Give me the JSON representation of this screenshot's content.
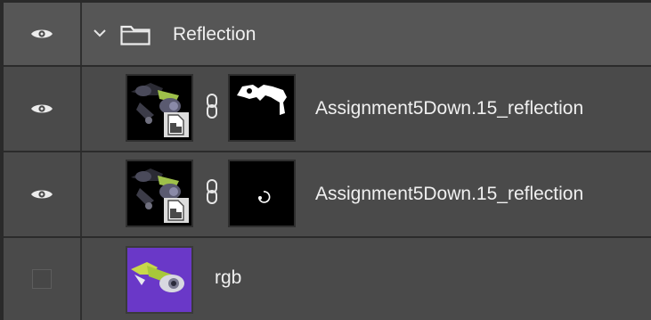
{
  "layers_panel": {
    "group": {
      "name": "Reflection",
      "visible": true,
      "expanded": true,
      "icons": [
        "eye-icon",
        "chevron-down-icon",
        "folder-icon"
      ]
    },
    "layers": [
      {
        "name": "Assignment5Down.15_reflection",
        "visible": true,
        "smart_object": true,
        "has_mask": true,
        "icons": [
          "eye-icon",
          "smart-object-icon",
          "chain-link-icon"
        ]
      },
      {
        "name": "Assignment5Down.15_reflection",
        "visible": true,
        "smart_object": true,
        "has_mask": true,
        "icons": [
          "eye-icon",
          "smart-object-icon",
          "chain-link-icon"
        ]
      },
      {
        "name": "rgb",
        "visible": false,
        "smart_object": false,
        "has_mask": false,
        "icons": [
          "visibility-toggle-icon"
        ]
      }
    ]
  },
  "colors": {
    "panel_bg": "#3c3c3c",
    "row_bg": "#4a4a4a",
    "group_row_bg": "#565656",
    "text": "#f0f0f0",
    "thumb_purple": "#6a38c8"
  }
}
